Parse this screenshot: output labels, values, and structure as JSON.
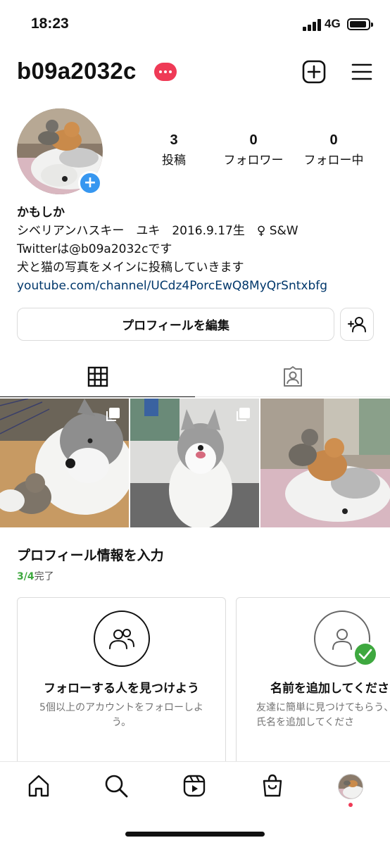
{
  "status_bar": {
    "time": "18:23",
    "network": "4G"
  },
  "header": {
    "username": "b09a2032c"
  },
  "stats": [
    {
      "count": "3",
      "label": "投稿"
    },
    {
      "count": "0",
      "label": "フォロワー"
    },
    {
      "count": "0",
      "label": "フォロー中"
    }
  ],
  "bio": {
    "name": "かもしか",
    "lines": [
      "シベリアンハスキー　ユキ　2016.9.17生　♀ S&W",
      "Twitterは@b09a2032cです",
      "犬と猫の写真をメインに投稿していきます"
    ],
    "link": "youtube.com/channel/UCdz4PorcEwQ8MyQrSntxbfg"
  },
  "buttons": {
    "edit_profile": "プロフィールを編集"
  },
  "completion": {
    "title": "プロフィール情報を入力",
    "progress_done": "3/4",
    "progress_suffix": "完了",
    "cards": [
      {
        "title": "フォローする人を見つけよう",
        "description": "5個以上のアカウントをフォローしよう。"
      },
      {
        "title": "名前を追加してくださ",
        "description": "友達に簡単に見つけてもらう、氏名を追加してくださ"
      }
    ]
  },
  "icons": {
    "create": "plus-square-icon",
    "menu": "hamburger-menu-icon",
    "grid_tab": "grid-icon",
    "tagged_tab": "tagged-person-icon",
    "discover": "add-person-icon",
    "nav": [
      "home-icon",
      "search-icon",
      "reels-icon",
      "shop-icon",
      "profile-avatar"
    ]
  },
  "colors": {
    "badge": "#ef3a56",
    "accent": "#3797f0",
    "link": "#00376b",
    "progress": "#3ea83f"
  }
}
